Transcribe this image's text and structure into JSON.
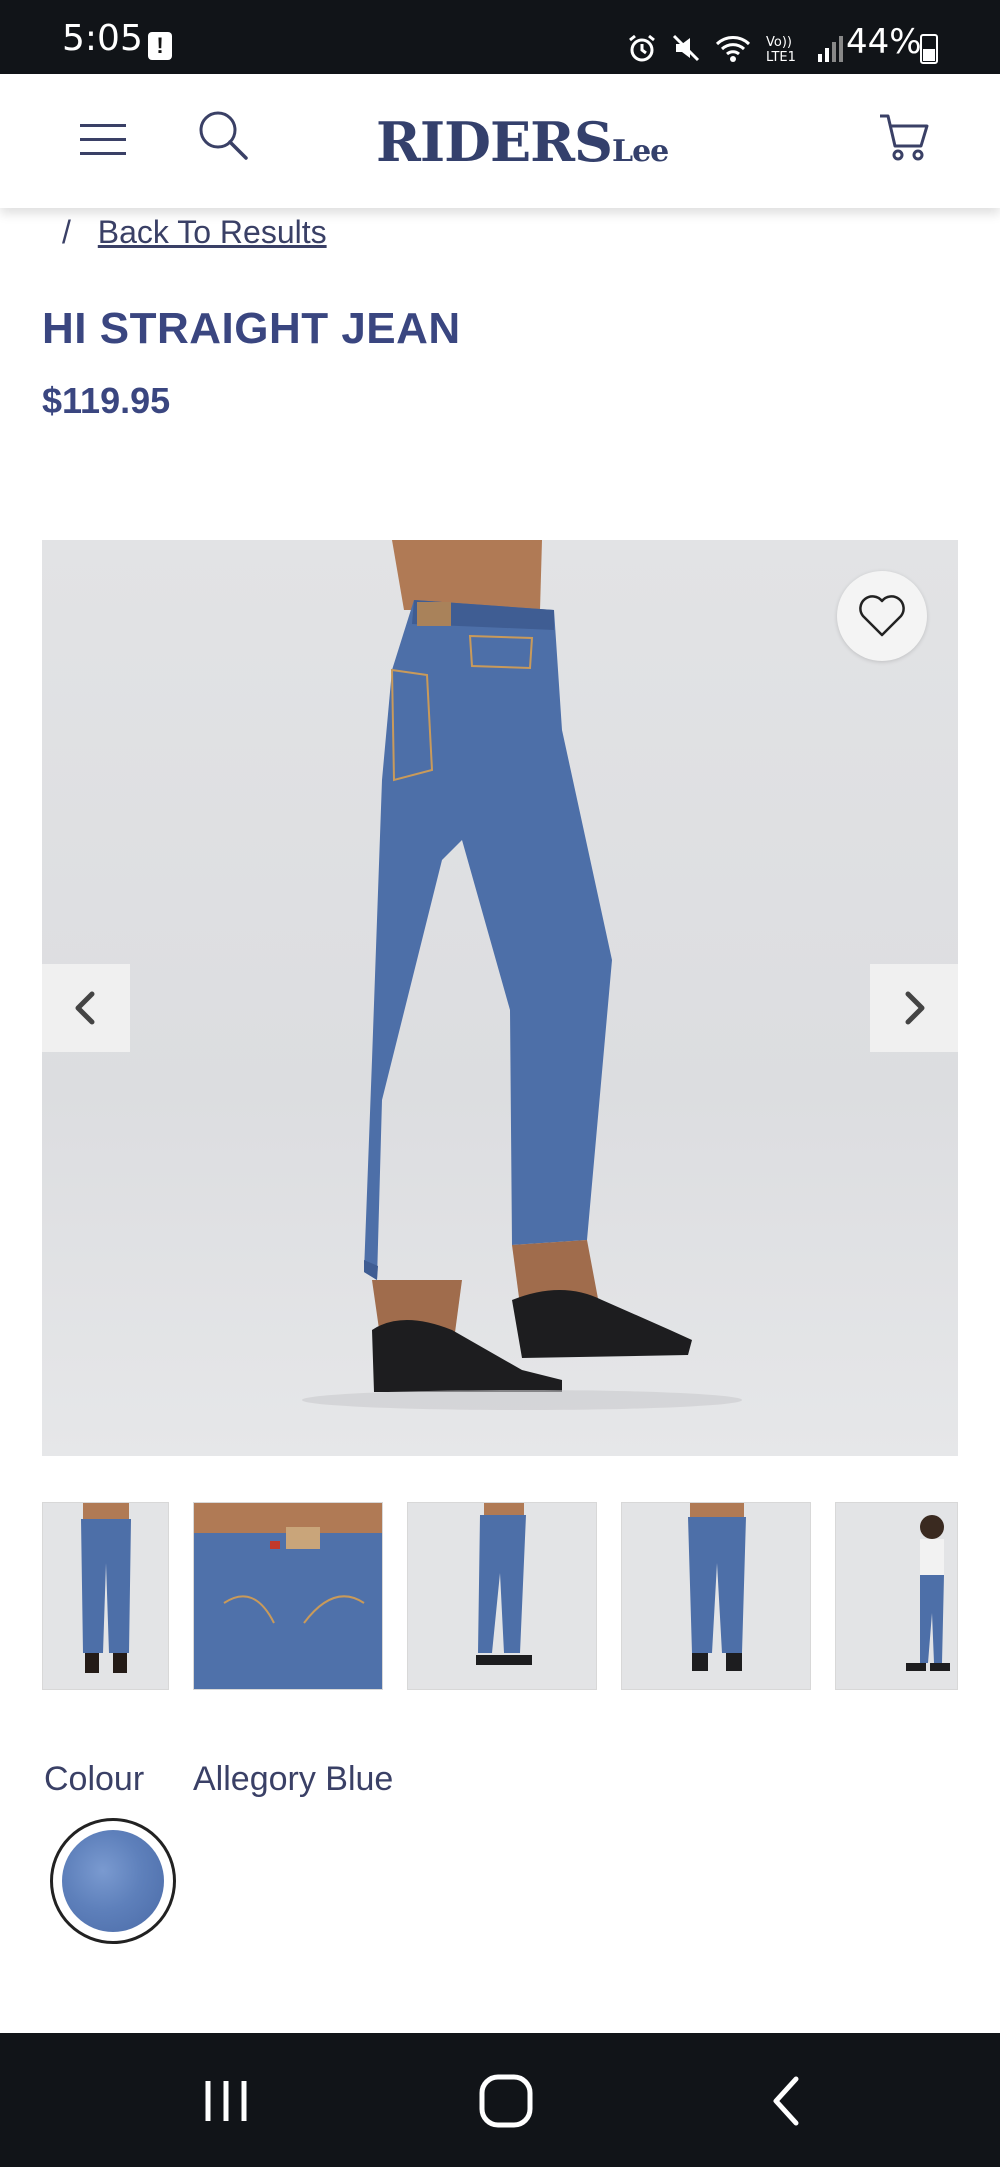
{
  "status_bar": {
    "time": "5:05",
    "battery": "44%",
    "alert_icon": "notification-alert-icon"
  },
  "header": {
    "menu_icon": "hamburger-menu-icon",
    "search_icon": "search-icon",
    "logo_main": "RIDERS",
    "logo_sub": "Lee",
    "cart_icon": "shopping-cart-icon"
  },
  "breadcrumb": {
    "separator": "/",
    "back_link": "Back To Results"
  },
  "product": {
    "title": "HI STRAIGHT JEAN",
    "price": "$119.95",
    "favorite_icon": "heart-icon",
    "prev_icon": "chevron-left-icon",
    "next_icon": "chevron-right-icon",
    "thumbnail_count": 5
  },
  "colour": {
    "label": "Colour",
    "value": "Allegory Blue"
  },
  "nav_bar": {
    "recent_icon": "recent-apps-icon",
    "home_icon": "home-icon",
    "back_icon": "back-icon"
  },
  "colors": {
    "brand": "#34406c",
    "text": "#3a4066",
    "denim": "#4a6aa6",
    "bar": "#111418"
  }
}
